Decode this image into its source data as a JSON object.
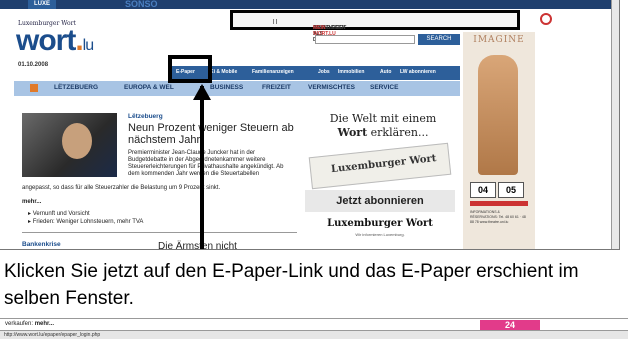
{
  "header": {
    "top_logo": "LUXE",
    "top_banner": "SONSO",
    "site_name": "Luxemburger Wort",
    "logo_main": "wort",
    "logo_dot": ".",
    "logo_suffix": "lu",
    "date": "01.10.2008",
    "login_status": "EINGELOGGT ALS DIFFUSION",
    "logout": "AUSLOGGEN",
    "my_wort": "MEIN WORT.LU",
    "search_button": "SEARCH"
  },
  "subnav": {
    "items": [
      "E-Paper",
      "Ki & Mobile",
      "Familienanzeigen",
      "Jobs",
      "Immobilien",
      "Auto",
      "LW abonnieren"
    ]
  },
  "mainnav": {
    "items": [
      "LËTZEBUERG",
      "EUROPA & WEL",
      "BUSINESS",
      "FREIZEIT",
      "VERMISCHTES",
      "SERVICE"
    ]
  },
  "article": {
    "kicker": "Lëtzebuerg",
    "headline": "Neun Prozent weniger Steuern ab nächstem Jahr",
    "teaser": "Premierminister Jean-Claude Juncker hat in der Budgetdebatte in der Abgeordnetenkammer weitere Steuererleichterungen für Privathaushalte angekündigt. Ab dem kommenden Jahr werden die Steuertabellen",
    "teaser_cont": "angepasst, so dass für alle Steuerzahler die Belastung um 9 Prozent sinkt.",
    "more": "mehr...",
    "bullets": [
      "Vernunft und Vorsicht",
      "Frieden: Weniger Lohnsteuern, mehr TVA"
    ],
    "bank_head": "Bankenkrise",
    "next_head": "Die Ärmsten nicht"
  },
  "promo": {
    "title_pre": "Die Welt mit einem",
    "title_bold": "Wort",
    "title_post": "erklären...",
    "paper_label": "Luxemburger Wort",
    "button": "Jetzt abonnieren",
    "brand": "Luxemburger Wort",
    "brand_sub": "Wir informieren Luxemburg."
  },
  "ad": {
    "title": "IMAGINE",
    "date1": "04",
    "date2": "05",
    "info": "INFORMATIONS & RÉSERVATIONS: Tel. 48 60 61 · 48 88 78 www.theatre.uni.lu"
  },
  "caption": "Klicken Sie jetzt auf den E-Paper-Link und das E-Paper erschient im selben Fenster.",
  "bottom": {
    "more_text": "verkaufen:",
    "more_link": "mehr...",
    "status_url": "http://www.wort.lu/epaper/epaper_login.php"
  },
  "colors": {
    "brand_blue": "#1b4d8c",
    "nav_light": "#a8c4e4",
    "accent_orange": "#e07a2a",
    "highlight_box": "#000000"
  }
}
